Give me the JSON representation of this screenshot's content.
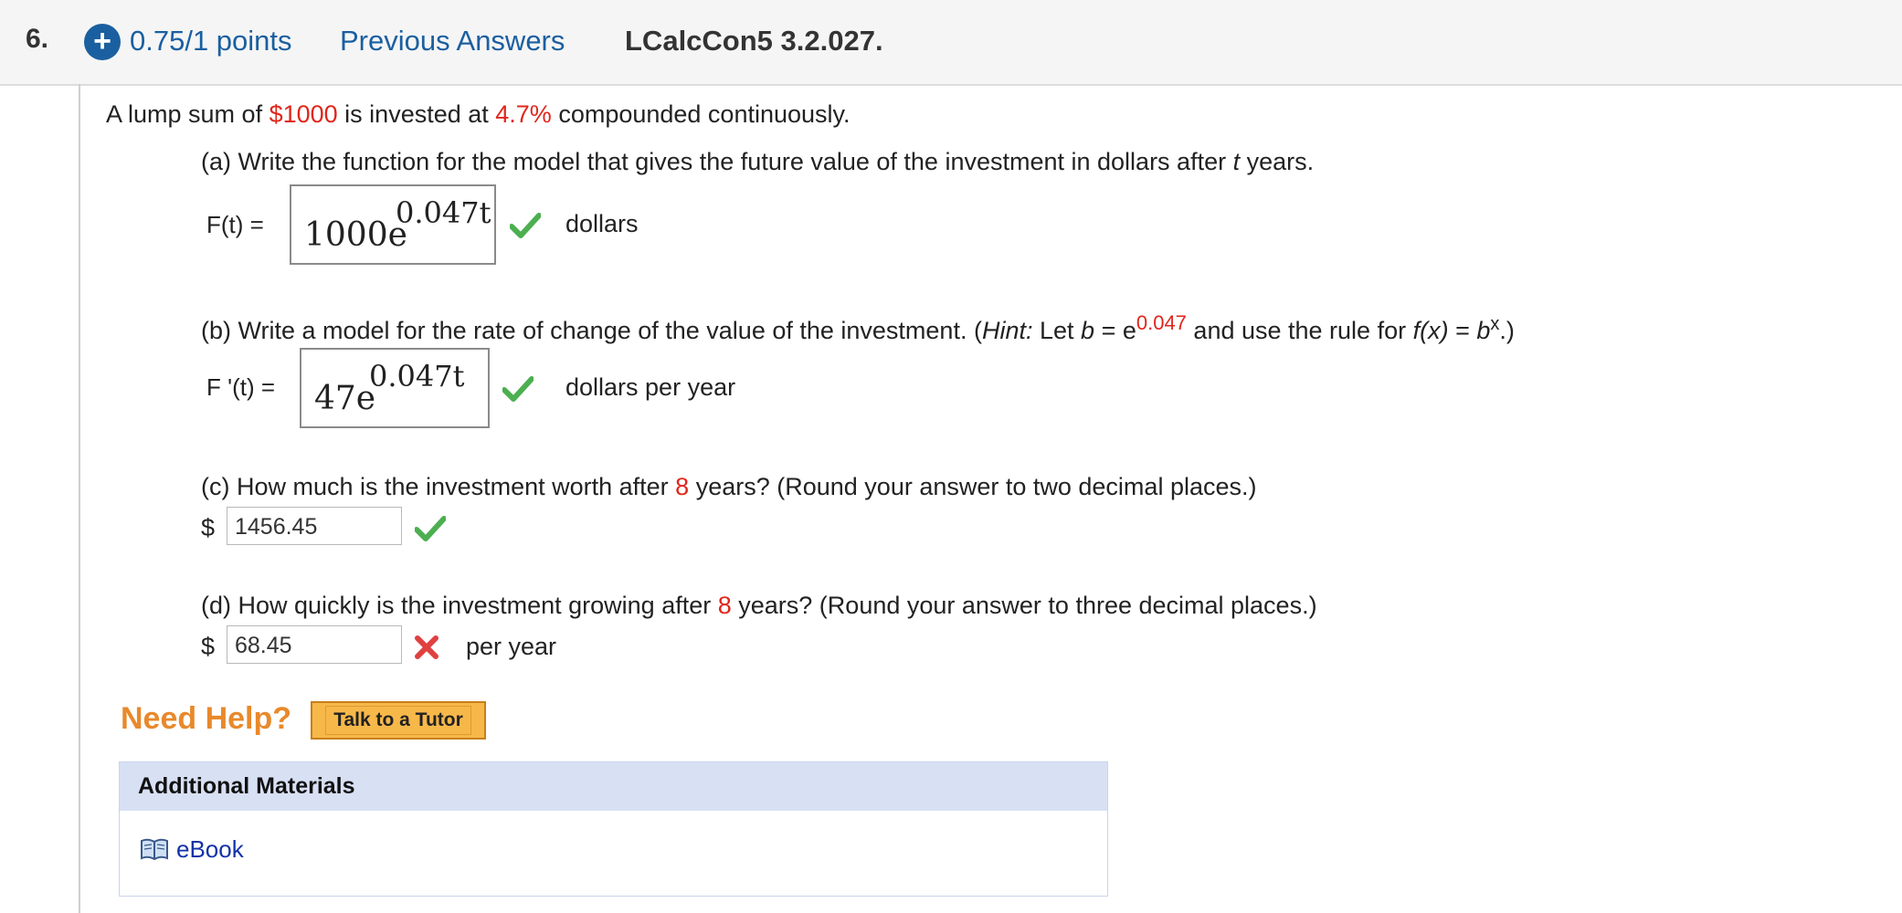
{
  "header": {
    "question_number": "6.",
    "plus_icon": "plus-circle-icon",
    "points": "0.75/1 points",
    "previous_answers": "Previous Answers",
    "problem_code": "LCalcCon5 3.2.027."
  },
  "intro": {
    "part1": "A lump sum of ",
    "amount": "$1000",
    "part2": " is invested at ",
    "rate": "4.7%",
    "part3": " compounded continuously."
  },
  "part_a": {
    "question_pre": "(a) Write the function for the model that gives the future value of the investment in dollars after ",
    "question_var": "t",
    "question_post": " years.",
    "label": "F(t) =",
    "answer_base": "1000e",
    "answer_exp": "0.047t",
    "unit": "dollars",
    "status": "correct"
  },
  "part_b": {
    "question_pre": "(b) Write a model for the rate of change of the value of the investment. (",
    "hint": "Hint:",
    "question_mid": " Let  ",
    "b_var": "b",
    "eq": " = e",
    "b_exp": "0.047",
    "question_mid2": "  and use the rule for  ",
    "f_label": "f(x)",
    "eq2": " = ",
    "bx_base": "b",
    "bx_exp": "x",
    "question_post": ".)",
    "label": "F '(t) =",
    "answer_base": "47e",
    "answer_exp": "0.047t",
    "unit": "dollars per year",
    "status": "correct"
  },
  "part_c": {
    "question_pre": "(c) How much is the investment worth after ",
    "years": "8",
    "question_post": " years? (Round your answer to two decimal places.)",
    "currency": "$",
    "value": "1456.45",
    "status": "correct"
  },
  "part_d": {
    "question_pre": "(d) How quickly is the investment growing after ",
    "years": "8",
    "question_post": " years? (Round your answer to three decimal places.)",
    "currency": "$",
    "value": "68.45",
    "unit": "per year",
    "status": "incorrect"
  },
  "help": {
    "need_help": "Need Help?",
    "tutor_button": "Talk to a Tutor"
  },
  "additional": {
    "title": "Additional Materials",
    "ebook_icon": "book-icon",
    "ebook_link": "eBook"
  },
  "colors": {
    "link_blue": "#1a5fa0",
    "highlight_red": "#e0261b",
    "check_green": "#4caf50",
    "x_red": "#e04040",
    "help_orange": "#e8892b"
  }
}
